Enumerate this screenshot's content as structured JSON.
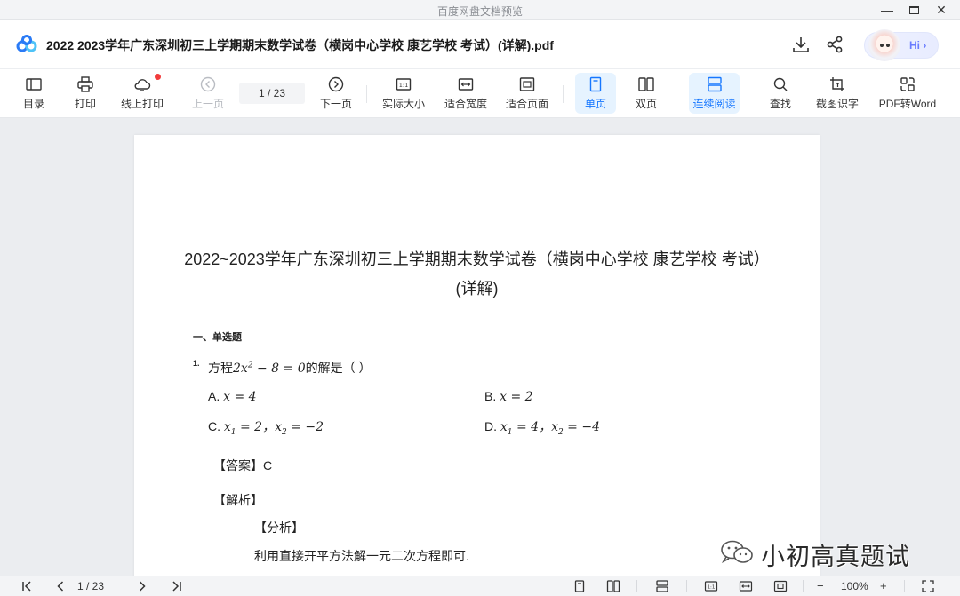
{
  "window": {
    "title": "百度网盘文档预览",
    "controls": [
      "minimize-icon",
      "maximize-icon",
      "close-icon"
    ]
  },
  "header": {
    "doc_title": "2022  2023学年广东深圳初三上学期期末数学试卷（横岗中心学校 康艺学校 考试）(详解).pdf",
    "icons": [
      "download-icon",
      "share-icon"
    ],
    "assistant_label": "Hi",
    "assistant_chevron": "›"
  },
  "toolbar": {
    "toc": "目录",
    "print": "打印",
    "online_print": "线上打印",
    "prev_page": "上一页",
    "page_indicator": "1  / 23",
    "next_page": "下一页",
    "actual_size": "实际大小",
    "fit_width": "适合宽度",
    "fit_page": "适合页面",
    "single_page": "单页",
    "double_page": "双页",
    "continuous": "连续阅读",
    "find": "查找",
    "ocr": "截图识字",
    "pdf_to_word": "PDF转Word",
    "accent_color": "#1677ff",
    "badge_color": "#f23c3c"
  },
  "document": {
    "title_line1": "2022~2023学年广东深圳初三上学期期末数学试卷（横岗中心学校 康艺学校 考试）",
    "title_line2": "(详解)",
    "section": "一、单选题",
    "q_number": "1.",
    "q_prefix": "方程",
    "q_math": "2x",
    "q_math_sup": "2",
    "q_math_tail": " − 8 = 0",
    "q_suffix": "的解是（    ）",
    "options": {
      "a_label": "A.",
      "a_math": "x = 4",
      "b_label": "B.",
      "b_math": "x = 2",
      "c_label": "C.",
      "c_math_1": "x",
      "c_sub_1": "1",
      "c_math_2": " = 2，",
      "c_math_3": "x",
      "c_sub_2": "2",
      "c_math_4": " = −2",
      "d_label": "D.",
      "d_math_1": "x",
      "d_sub_1": "1",
      "d_math_2": " = 4，",
      "d_math_3": "x",
      "d_sub_2": "2",
      "d_math_4": " = −4"
    },
    "answer": "【答案】C",
    "analysis_heading": "【解析】",
    "analysis_sub": "【分析】",
    "analysis_text": "利用直接开平方法解一元二次方程即可."
  },
  "watermark": {
    "text": "小初高真题试卷",
    "icon": "wechat-icon"
  },
  "statusbar": {
    "page_indicator": "1  / 23",
    "zoom_minus": "−",
    "zoom": "100%",
    "zoom_plus": "+"
  }
}
